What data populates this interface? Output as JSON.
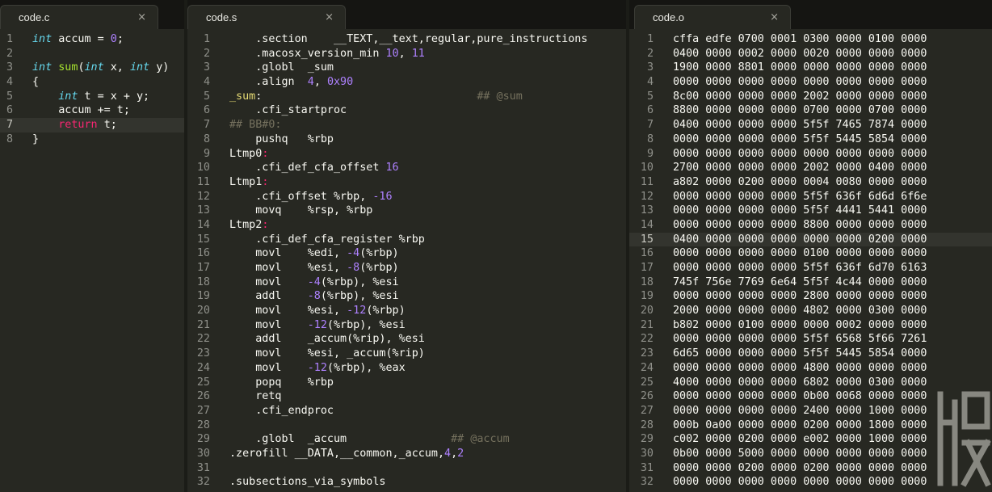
{
  "tabs": [
    {
      "label": "code.c",
      "close": "×"
    },
    {
      "label": "code.s",
      "close": "×"
    },
    {
      "label": "code.o",
      "close": "×"
    }
  ],
  "code_c": {
    "highlight_line": 7,
    "lines": [
      [
        [
          "k",
          "int"
        ],
        [
          "",
          "accum = "
        ],
        [
          "n",
          "0"
        ],
        [
          "",
          ";"
        ]
      ],
      [],
      [
        [
          "k",
          "int"
        ],
        [
          "",
          ""
        ],
        [
          "f",
          "sum"
        ],
        [
          "",
          "("
        ],
        [
          "k",
          "int"
        ],
        [
          "",
          "x, "
        ],
        [
          "k",
          "int"
        ],
        [
          "",
          "y)"
        ]
      ],
      [
        [
          "",
          "{"
        ]
      ],
      [
        [
          "",
          "    "
        ],
        [
          "k",
          "int"
        ],
        [
          "",
          "t = x + y;"
        ]
      ],
      [
        [
          "",
          "    accum += t;"
        ]
      ],
      [
        [
          "",
          "    "
        ],
        [
          "r",
          "return"
        ],
        [
          "",
          "t;"
        ]
      ],
      [
        [
          "",
          "}"
        ]
      ]
    ]
  },
  "code_s": {
    "lines": [
      [
        [
          "",
          "    .section    __TEXT,__text,regular,pure_instructions"
        ]
      ],
      [
        [
          "",
          "    .macosx_version_min "
        ],
        [
          "n",
          "10"
        ],
        [
          "",
          ", "
        ],
        [
          "n",
          "11"
        ]
      ],
      [
        [
          "",
          "    .globl  _sum"
        ]
      ],
      [
        [
          "",
          "    .align  "
        ],
        [
          "n",
          "4"
        ],
        [
          "",
          ", "
        ],
        [
          "n",
          "0x90"
        ]
      ],
      [
        [
          "l",
          "_sum"
        ],
        [
          "",
          ":                                 "
        ],
        [
          "c",
          "## @sum"
        ]
      ],
      [
        [
          "",
          "    .cfi_startproc"
        ]
      ],
      [
        [
          "c",
          "## BB#0:"
        ]
      ],
      [
        [
          "",
          "    pushq   %rbp"
        ]
      ],
      [
        [
          "",
          "Ltmp0"
        ],
        [
          "r",
          ":"
        ]
      ],
      [
        [
          "",
          "    .cfi_def_cfa_offset "
        ],
        [
          "n",
          "16"
        ]
      ],
      [
        [
          "",
          "Ltmp1"
        ],
        [
          "r",
          ":"
        ]
      ],
      [
        [
          "",
          "    .cfi_offset %rbp, "
        ],
        [
          "n",
          "-16"
        ]
      ],
      [
        [
          "",
          "    movq    %rsp, %rbp"
        ]
      ],
      [
        [
          "",
          "Ltmp2"
        ],
        [
          "r",
          ":"
        ]
      ],
      [
        [
          "",
          "    .cfi_def_cfa_register %rbp"
        ]
      ],
      [
        [
          "",
          "    movl    %edi, "
        ],
        [
          "n",
          "-4"
        ],
        [
          "",
          "(%rbp)"
        ]
      ],
      [
        [
          "",
          "    movl    %esi, "
        ],
        [
          "n",
          "-8"
        ],
        [
          "",
          "(%rbp)"
        ]
      ],
      [
        [
          "",
          "    movl    "
        ],
        [
          "n",
          "-4"
        ],
        [
          "",
          "(%rbp), %esi"
        ]
      ],
      [
        [
          "",
          "    addl    "
        ],
        [
          "n",
          "-8"
        ],
        [
          "",
          "(%rbp), %esi"
        ]
      ],
      [
        [
          "",
          "    movl    %esi, "
        ],
        [
          "n",
          "-12"
        ],
        [
          "",
          "(%rbp)"
        ]
      ],
      [
        [
          "",
          "    movl    "
        ],
        [
          "n",
          "-12"
        ],
        [
          "",
          "(%rbp), %esi"
        ]
      ],
      [
        [
          "",
          "    addl    _accum(%rip), %esi"
        ]
      ],
      [
        [
          "",
          "    movl    %esi, _accum(%rip)"
        ]
      ],
      [
        [
          "",
          "    movl    "
        ],
        [
          "n",
          "-12"
        ],
        [
          "",
          "(%rbp), %eax"
        ]
      ],
      [
        [
          "",
          "    popq    %rbp"
        ]
      ],
      [
        [
          "",
          "    retq"
        ]
      ],
      [
        [
          "",
          "    .cfi_endproc"
        ]
      ],
      [],
      [
        [
          "",
          "    .globl  _accum                "
        ],
        [
          "c",
          "## @accum"
        ]
      ],
      [
        [
          "",
          ".zerofill __DATA,__common,_accum,"
        ],
        [
          "n",
          "4"
        ],
        [
          "",
          ","
        ],
        [
          "n",
          "2"
        ]
      ],
      [],
      [
        [
          "",
          ".subsections_via_symbols"
        ]
      ]
    ]
  },
  "code_o": {
    "highlight_line": 15,
    "lines": [
      "cffa edfe 0700 0001 0300 0000 0100 0000",
      "0400 0000 0002 0000 0020 0000 0000 0000",
      "1900 0000 8801 0000 0000 0000 0000 0000",
      "0000 0000 0000 0000 0000 0000 0000 0000",
      "8c00 0000 0000 0000 2002 0000 0000 0000",
      "8800 0000 0000 0000 0700 0000 0700 0000",
      "0400 0000 0000 0000 5f5f 7465 7874 0000",
      "0000 0000 0000 0000 5f5f 5445 5854 0000",
      "0000 0000 0000 0000 0000 0000 0000 0000",
      "2700 0000 0000 0000 2002 0000 0400 0000",
      "a802 0000 0200 0000 0004 0080 0000 0000",
      "0000 0000 0000 0000 5f5f 636f 6d6d 6f6e",
      "0000 0000 0000 0000 5f5f 4441 5441 0000",
      "0000 0000 0000 0000 8800 0000 0000 0000",
      "0400 0000 0000 0000 0000 0000 0200 0000",
      "0000 0000 0000 0000 0100 0000 0000 0000",
      "0000 0000 0000 0000 5f5f 636f 6d70 6163",
      "745f 756e 7769 6e64 5f5f 4c44 0000 0000",
      "0000 0000 0000 0000 2800 0000 0000 0000",
      "2000 0000 0000 0000 4802 0000 0300 0000",
      "b802 0000 0100 0000 0000 0002 0000 0000",
      "0000 0000 0000 0000 5f5f 6568 5f66 7261",
      "6d65 0000 0000 0000 5f5f 5445 5854 0000",
      "0000 0000 0000 0000 4800 0000 0000 0000",
      "4000 0000 0000 0000 6802 0000 0300 0000",
      "0000 0000 0000 0000 0b00 0068 0000 0000",
      "0000 0000 0000 0000 2400 0000 1000 0000",
      "000b 0a00 0000 0000 0200 0000 1800 0000",
      "c002 0000 0200 0000 e002 0000 1000 0000",
      "0b00 0000 5000 0000 0000 0000 0000 0000",
      "0000 0000 0200 0000 0200 0000 0000 0000",
      "0000 0000 0000 0000 0000 0000 0000 0000"
    ]
  },
  "colors": {
    "background": "#272822",
    "keyword": "#66d9ef",
    "return": "#f92672",
    "number": "#ae81ff",
    "function": "#a6e22e",
    "comment": "#75715e",
    "label": "#e6db74"
  }
}
